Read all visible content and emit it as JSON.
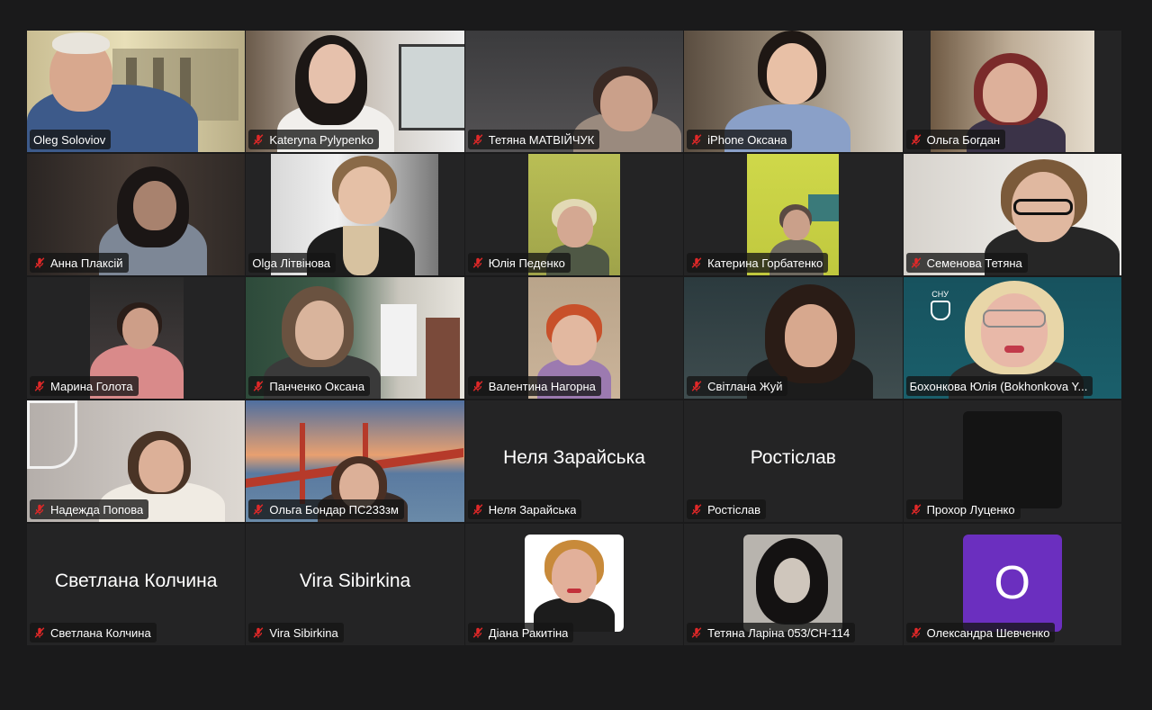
{
  "meeting": {
    "participants": [
      {
        "name": "Oleg Soloviov",
        "muted": false
      },
      {
        "name": "Kateryna Pylypenko",
        "muted": true
      },
      {
        "name": "Тетяна МАТВІЙЧУК",
        "muted": true
      },
      {
        "name": "iPhone Оксана",
        "muted": true
      },
      {
        "name": "Ольга Богдан",
        "muted": true
      },
      {
        "name": "Анна Плаксій",
        "muted": true
      },
      {
        "name": "Olga Літвінова",
        "muted": false
      },
      {
        "name": "Юлія Педенко",
        "muted": true
      },
      {
        "name": "Катерина Горбатенко",
        "muted": true
      },
      {
        "name": "Семенова Тетяна",
        "muted": true
      },
      {
        "name": "Марина Голота",
        "muted": true
      },
      {
        "name": "Панченко Оксана",
        "muted": true
      },
      {
        "name": "Валентина Нагорна",
        "muted": true
      },
      {
        "name": "Світлана Жуй",
        "muted": true
      },
      {
        "name": "Бохонкова Юлія (Bokhonkova Y...",
        "muted": false,
        "active_speaker": true,
        "logo_text": "СНУ"
      },
      {
        "name": "Надежда Попова",
        "muted": true
      },
      {
        "name": "Ольга Бондар ПС233зм",
        "muted": true
      },
      {
        "name": "Неля Зарайська",
        "muted": true,
        "video_off": true,
        "center_label": "Неля Зарайська"
      },
      {
        "name": "Ростіслав",
        "muted": true,
        "video_off": true,
        "center_label": "Ростіслав"
      },
      {
        "name": "Прохор Луценко",
        "muted": true,
        "video_off": true
      },
      {
        "name": "Светлана Колчина",
        "muted": true,
        "video_off": true,
        "center_label": "Светлана Колчина"
      },
      {
        "name": "Vira Sibirkina",
        "muted": true,
        "video_off": true,
        "center_label": "Vira Sibirkina"
      },
      {
        "name": "Діана Ракитіна",
        "muted": true,
        "video_off": true
      },
      {
        "name": "Тетяна Ларіна 053/СН-114",
        "muted": true,
        "video_off": true
      },
      {
        "name": "Олександра Шевченко",
        "muted": true,
        "video_off": true,
        "avatar_letter": "O"
      }
    ]
  },
  "colors": {
    "background": "#1a1a1b",
    "tile": "#242425",
    "active_speaker_border": "#3cc451",
    "muted_icon": "#e02828",
    "letter_avatar": "#6b2fbf"
  },
  "icons": {
    "muted": "microphone-muted-icon"
  }
}
